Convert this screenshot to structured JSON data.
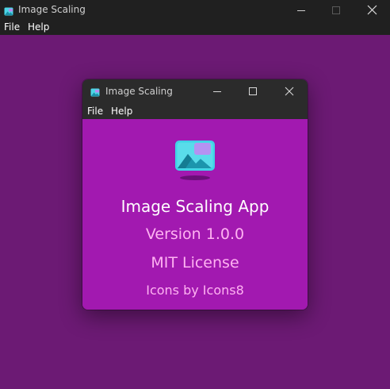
{
  "main_window": {
    "title": "Image Scaling",
    "menu": [
      "File",
      "Help"
    ],
    "controls": [
      "minimize-icon",
      "maximize-icon",
      "close-icon"
    ]
  },
  "about_dialog": {
    "title": "Image Scaling",
    "menu": [
      "File",
      "Help"
    ],
    "controls": [
      "minimize-icon",
      "maximize-icon",
      "close-icon"
    ],
    "icon": "image-gallery-icon",
    "app_name": "Image Scaling App",
    "version": "Version 1.0.0",
    "license": "MIT License",
    "credits": "Icons by Icons8"
  },
  "colors": {
    "background": "#6c1a74",
    "dialog_background": "#a219b0",
    "titlebar": "#202020",
    "dialog_titlebar": "#2b2b2b",
    "primary_text": "#ffffff",
    "secondary_text": "#ffb3f2"
  }
}
